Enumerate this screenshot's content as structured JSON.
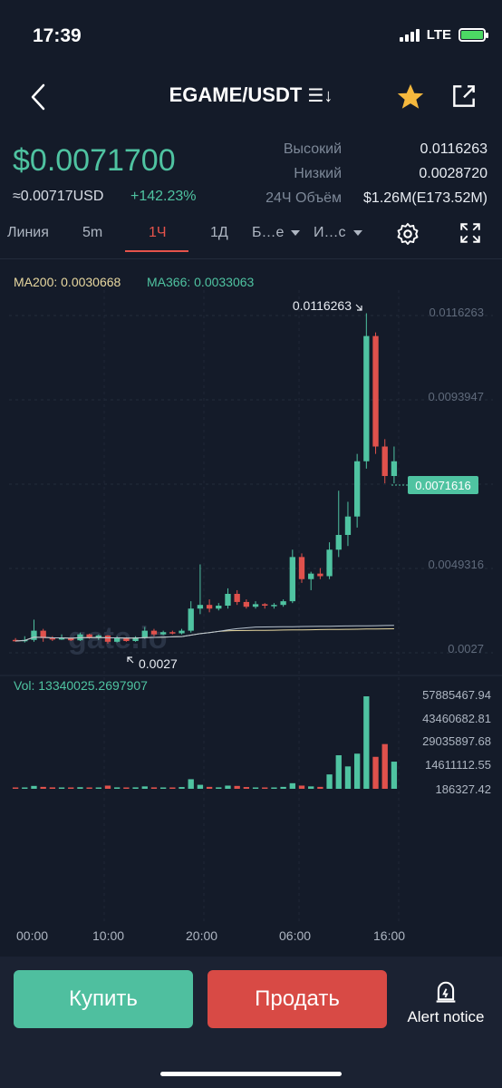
{
  "status": {
    "time": "17:39",
    "network": "LTE"
  },
  "header": {
    "pair": "EGAME/USDT",
    "sort_glyph": "☰↓"
  },
  "price": {
    "last": "$0.0071700",
    "usd": "≈0.00717USD",
    "change": "+142.23%"
  },
  "stats": {
    "high_label": "Высокий",
    "high_value": "0.0116263",
    "low_label": "Низкий",
    "low_value": "0.0028720",
    "vol_label": "24Ч Объём",
    "vol_value": "$1.26M(E173.52M)"
  },
  "tabs": {
    "line": "Линия",
    "m5": "5m",
    "h1": "1Ч",
    "d1": "1Д",
    "more": "Б…е",
    "indicators": "И…с"
  },
  "ma": {
    "ma200": "MA200: 0.0030668",
    "ma366": "MA366: 0.0033063"
  },
  "colors": {
    "up": "#4fc3a1",
    "down": "#e0514c",
    "ma200": "#e8d8a0",
    "ma366": "#b8c4d0",
    "bg": "#141b29"
  },
  "chart_data": {
    "type": "candlestick",
    "price_axis": [
      "0.0116263",
      "0.0093947",
      "0.0049316",
      "0.0027"
    ],
    "current_price_tag": "0.0071616",
    "high_annotation": "0.0116263",
    "low_annotation": "0.0027",
    "ylim": [
      0.0024,
      0.012
    ],
    "candles": [
      [
        0.00275,
        0.0028,
        0.0027,
        0.00272
      ],
      [
        0.00272,
        0.00285,
        0.00268,
        0.00275
      ],
      [
        0.00275,
        0.0033,
        0.0027,
        0.003
      ],
      [
        0.003,
        0.00305,
        0.0027,
        0.0028
      ],
      [
        0.0028,
        0.00285,
        0.00272,
        0.00276
      ],
      [
        0.00276,
        0.0029,
        0.00275,
        0.0028
      ],
      [
        0.0028,
        0.00282,
        0.00272,
        0.00274
      ],
      [
        0.00274,
        0.00295,
        0.00272,
        0.0029
      ],
      [
        0.0029,
        0.00292,
        0.00278,
        0.00282
      ],
      [
        0.00282,
        0.0029,
        0.00275,
        0.00287
      ],
      [
        0.00287,
        0.00288,
        0.00265,
        0.0027
      ],
      [
        0.0027,
        0.00285,
        0.00268,
        0.0028
      ],
      [
        0.0028,
        0.00282,
        0.0027,
        0.00272
      ],
      [
        0.00272,
        0.00285,
        0.0027,
        0.00282
      ],
      [
        0.00282,
        0.0031,
        0.00278,
        0.003
      ],
      [
        0.003,
        0.00305,
        0.00285,
        0.0029
      ],
      [
        0.0029,
        0.003,
        0.00288,
        0.00296
      ],
      [
        0.00296,
        0.003,
        0.0029,
        0.00293
      ],
      [
        0.00293,
        0.00305,
        0.0029,
        0.003
      ],
      [
        0.003,
        0.0038,
        0.00295,
        0.0036
      ],
      [
        0.0036,
        0.0048,
        0.00345,
        0.0037
      ],
      [
        0.0037,
        0.00385,
        0.0035,
        0.0036
      ],
      [
        0.0036,
        0.00375,
        0.00355,
        0.00368
      ],
      [
        0.00368,
        0.00415,
        0.0036,
        0.004
      ],
      [
        0.004,
        0.0041,
        0.0037,
        0.00378
      ],
      [
        0.00378,
        0.00385,
        0.0036,
        0.00365
      ],
      [
        0.00365,
        0.0038,
        0.0036,
        0.00372
      ],
      [
        0.00372,
        0.00375,
        0.0036,
        0.00368
      ],
      [
        0.00368,
        0.00375,
        0.0036,
        0.0037
      ],
      [
        0.0037,
        0.00385,
        0.00365,
        0.0038
      ],
      [
        0.0038,
        0.0052,
        0.00375,
        0.005
      ],
      [
        0.005,
        0.0051,
        0.0043,
        0.0044
      ],
      [
        0.0044,
        0.0046,
        0.0041,
        0.00455
      ],
      [
        0.00455,
        0.0047,
        0.0044,
        0.00448
      ],
      [
        0.00448,
        0.0054,
        0.0044,
        0.0052
      ],
      [
        0.0052,
        0.0068,
        0.005,
        0.0056
      ],
      [
        0.0056,
        0.0065,
        0.0053,
        0.0061
      ],
      [
        0.0061,
        0.0078,
        0.0058,
        0.0076
      ],
      [
        0.0076,
        0.01162,
        0.0074,
        0.011
      ],
      [
        0.011,
        0.0111,
        0.0078,
        0.008
      ],
      [
        0.008,
        0.0082,
        0.007,
        0.0072
      ],
      [
        0.0072,
        0.008,
        0.007,
        0.0076
      ]
    ],
    "volume_axis": [
      "57885467.94",
      "43460682.81",
      "29035897.68",
      "14611112.55",
      "186327.42"
    ],
    "volume_label": "Vol: 13340025.2697907",
    "volumes": [
      186327,
      186327,
      1800000,
      1200000,
      900000,
      700000,
      600000,
      1000000,
      800000,
      600000,
      2000000,
      900000,
      700000,
      900000,
      1500000,
      900000,
      800000,
      700000,
      1100000,
      6000000,
      2500000,
      1200000,
      900000,
      2000000,
      1800000,
      1100000,
      800000,
      700000,
      800000,
      1200000,
      3500000,
      2000000,
      1500000,
      1200000,
      9000000,
      21000000,
      14000000,
      22000000,
      57885467,
      20000000,
      28000000,
      17000000
    ],
    "x_ticks": [
      "00:00",
      "10:00",
      "20:00",
      "06:00",
      "16:00"
    ]
  },
  "actions": {
    "buy": "Купить",
    "sell": "Продать",
    "alert": "Alert notice"
  },
  "watermark": "gate.io"
}
